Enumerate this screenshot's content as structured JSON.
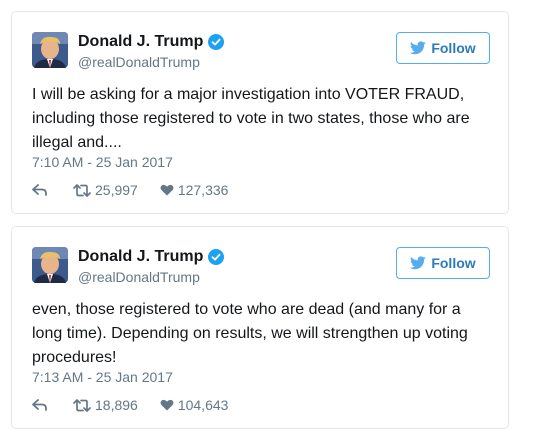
{
  "author": {
    "name": "Donald J. Trump",
    "handle": "@realDonaldTrump",
    "avatar_icon": "profile-photo",
    "verified_icon": "verified-badge-icon"
  },
  "colors": {
    "accent": "#55acee",
    "link": "#2b7bb9",
    "muted": "#657786",
    "border": "#e1e8ed"
  },
  "follow_label": "Follow",
  "tweets": [
    {
      "text": "I will be asking for a major investigation into VOTER FRAUD, including those registered to vote in two states, those who are illegal and....",
      "time": "7:10 AM - 25 Jan 2017",
      "retweets": "25,997",
      "likes": "127,336"
    },
    {
      "text": "even, those registered to vote who are dead (and many for a long time). Depending on results, we will strengthen up voting procedures!",
      "time": "7:13 AM - 25 Jan 2017",
      "retweets": "18,896",
      "likes": "104,643"
    }
  ]
}
